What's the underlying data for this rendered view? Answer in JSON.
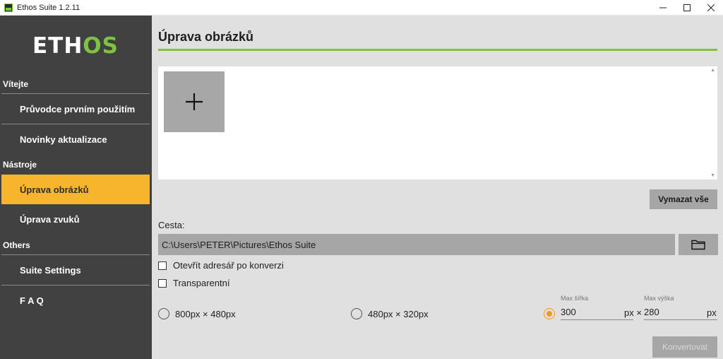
{
  "window": {
    "title": "Ethos Suite 1.2.11",
    "icon": "ethos-app-icon",
    "controls": [
      "minimize-icon",
      "maximize-icon",
      "close-icon"
    ]
  },
  "sidebar": {
    "logo": {
      "part1": "ETH",
      "part2": "OS"
    },
    "sections": [
      {
        "label": "Vítejte",
        "items": [
          {
            "label": "Průvodce prvním použitím"
          },
          {
            "label": "Novinky aktualizace"
          }
        ]
      },
      {
        "label": "Nástroje",
        "items": [
          {
            "label": "Úprava obrázků",
            "active": true
          },
          {
            "label": "Úprava zvuků"
          }
        ]
      },
      {
        "label": "Others",
        "items": [
          {
            "label": "Suite Settings"
          },
          {
            "label": "F A Q"
          }
        ]
      }
    ]
  },
  "main": {
    "title": "Úprava obrázků",
    "add_tile_icon": "plus-icon",
    "clear_all_label": "Vymazat vše",
    "path_label": "Cesta:",
    "path_value": "C:\\Users\\PETER\\Pictures\\Ethos Suite",
    "folder_icon": "folder-icon",
    "checkboxes": [
      {
        "label": "Otevřít adresář po konverzi",
        "checked": false
      },
      {
        "label": "Transparentní",
        "checked": false
      }
    ],
    "sizes": [
      {
        "label": "800px × 480px",
        "selected": false
      },
      {
        "label": "480px × 320px",
        "selected": false
      }
    ],
    "custom_size": {
      "selected": true,
      "max_width_label": "Max šířka",
      "max_width_value": "300",
      "unit_times": "px ×",
      "max_height_label": "Max výška",
      "max_height_value": "280",
      "unit": "px"
    },
    "convert_label": "Konvertovat"
  },
  "colors": {
    "sidebar_bg": "#424141",
    "accent_green": "#7ec242",
    "active_item": "#f6b52d",
    "radio_selected": "#f29a1c",
    "main_bg": "#e0e0e0",
    "button_gray": "#a6a6a6"
  }
}
